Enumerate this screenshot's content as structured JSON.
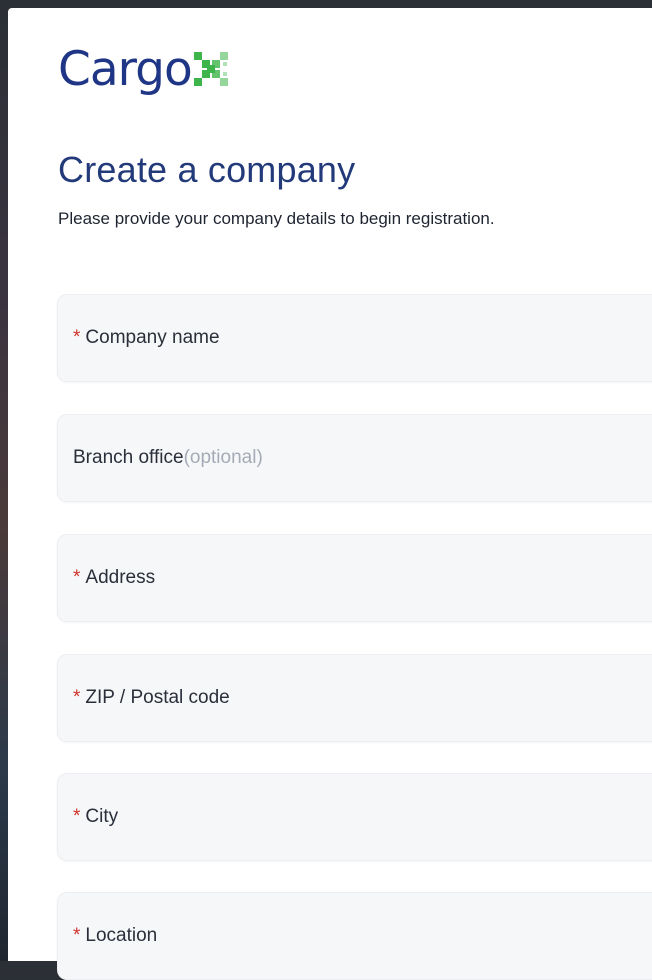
{
  "brand": {
    "name": "Cargo",
    "mark": "X",
    "text_color": "#1f3586",
    "mark_color": "#3db54a"
  },
  "page": {
    "title": "Create a company",
    "subtitle": "Please provide your company details to begin registration."
  },
  "form": {
    "required_marker": "*",
    "fields": [
      {
        "label": "Company name",
        "required": true
      },
      {
        "label": "Branch office",
        "required": false,
        "suffix": "(optional)"
      },
      {
        "label": "Address",
        "required": true
      },
      {
        "label": "ZIP / Postal code",
        "required": true
      },
      {
        "label": "City",
        "required": true
      },
      {
        "label": "Location",
        "required": true
      }
    ]
  }
}
